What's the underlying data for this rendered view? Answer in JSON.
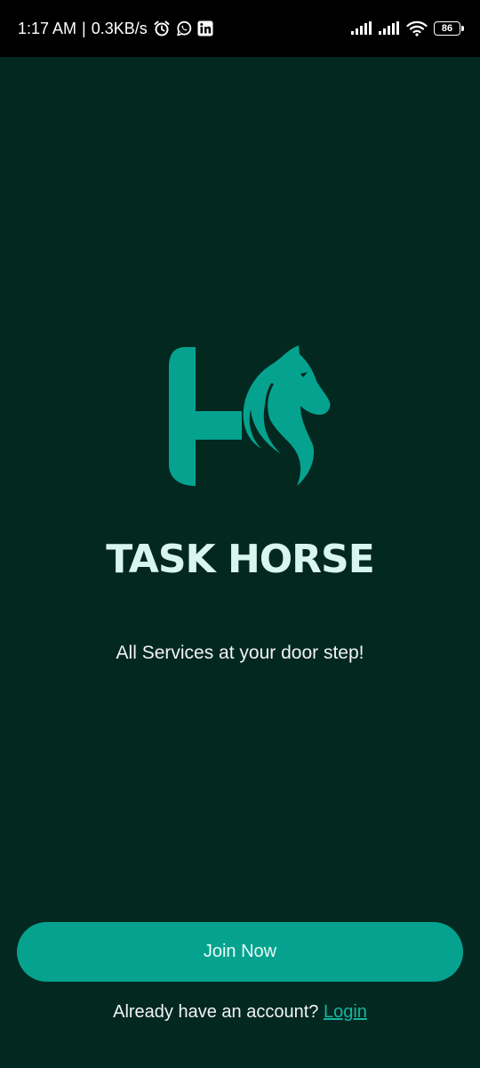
{
  "status_bar": {
    "time": "1:17 AM",
    "separator": "|",
    "speed": "0.3KB/s",
    "battery_level": "86",
    "icons": [
      "alarm-icon",
      "whatsapp-icon",
      "linkedin-icon",
      "signal-icon",
      "signal-icon",
      "wifi-icon",
      "battery-icon"
    ]
  },
  "brand": {
    "name": "TASK HORSE",
    "tagline": "All Services at your door step!",
    "logo_icon": "horse-logo-icon",
    "accent_color": "#05a38f",
    "background_color": "#032820"
  },
  "actions": {
    "join_label": "Join Now",
    "login_prompt": "Already have an account?",
    "login_label": "Login"
  }
}
